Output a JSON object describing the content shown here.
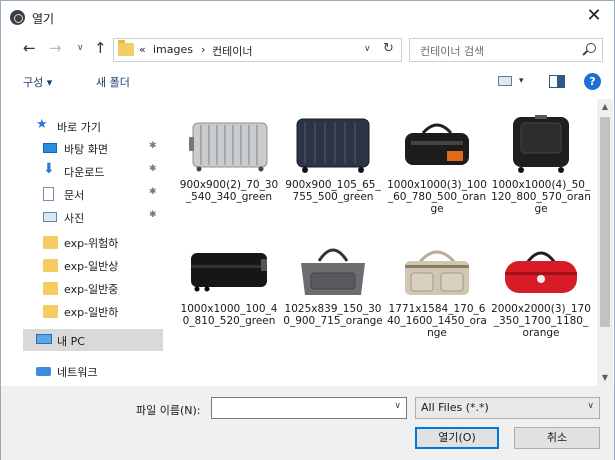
{
  "window": {
    "title": "열기",
    "close_glyph": "✕"
  },
  "nav": {
    "back_glyph": "←",
    "forward_glyph": "→",
    "recent_glyph": "∨",
    "up_glyph": "↑",
    "breadcrumbs": [
      "«",
      "images",
      "›",
      "컨테이너"
    ],
    "dropdown_glyph": "∨",
    "refresh_glyph": "↻",
    "search_placeholder": "컨테이너 검색"
  },
  "toolbar": {
    "organize_label": "구성 ▾",
    "new_folder_label": "새 폴더",
    "view_caret": "▾",
    "help_label": "?"
  },
  "sidebar": {
    "items": [
      {
        "label": "바로 가기",
        "icon": "star-icon",
        "pinned": false
      },
      {
        "label": "바탕 화면",
        "icon": "desktop-icon",
        "pinned": true
      },
      {
        "label": "다운로드",
        "icon": "download-icon",
        "pinned": true
      },
      {
        "label": "문서",
        "icon": "document-icon",
        "pinned": true
      },
      {
        "label": "사진",
        "icon": "pictures-icon",
        "pinned": true
      },
      {
        "label": "exp-위험하",
        "icon": "folder-icon",
        "pinned": false
      },
      {
        "label": "exp-일반상",
        "icon": "folder-icon",
        "pinned": false
      },
      {
        "label": "exp-일반중",
        "icon": "folder-icon",
        "pinned": false
      },
      {
        "label": "exp-일반하",
        "icon": "folder-icon",
        "pinned": false
      },
      {
        "label": "내 PC",
        "icon": "pc-icon",
        "pinned": false,
        "selected": true
      },
      {
        "label": "네트워크",
        "icon": "network-icon",
        "pinned": false
      }
    ],
    "pin_glyph": "📌"
  },
  "files": [
    {
      "name": "900x900(2)_70_30_540_340_green",
      "kind": "silver-suitcase"
    },
    {
      "name": "900x900_105_65_755_500_green",
      "kind": "navy-suitcase"
    },
    {
      "name": "1000x1000(3)_100_60_780_500_orange",
      "kind": "black-duffel"
    },
    {
      "name": "1000x1000(4)_50_120_800_570_orange",
      "kind": "black-trolley"
    },
    {
      "name": "1000x1000_100_40_810_520_green",
      "kind": "black-case"
    },
    {
      "name": "1025x839_150_300_900_715_orange",
      "kind": "gray-bag"
    },
    {
      "name": "1771x1584_170_640_1600_1450_orange",
      "kind": "beige-bag"
    },
    {
      "name": "2000x2000(3)_170_350_1700_1180_orange",
      "kind": "red-duffel"
    },
    {
      "name": "",
      "kind": "partial-1"
    },
    {
      "name": "",
      "kind": "partial-2"
    },
    {
      "name": "",
      "kind": "partial-3"
    },
    {
      "name": "",
      "kind": "partial-4"
    }
  ],
  "bottom": {
    "filename_label": "파일 이름(N):",
    "filename_value": "",
    "filetype_value": "All Files (*.*)",
    "dropdown_glyph": "∨",
    "open_label": "열기(O)",
    "cancel_label": "취소"
  },
  "scroll": {
    "up_glyph": "▲",
    "down_glyph": "▼"
  }
}
